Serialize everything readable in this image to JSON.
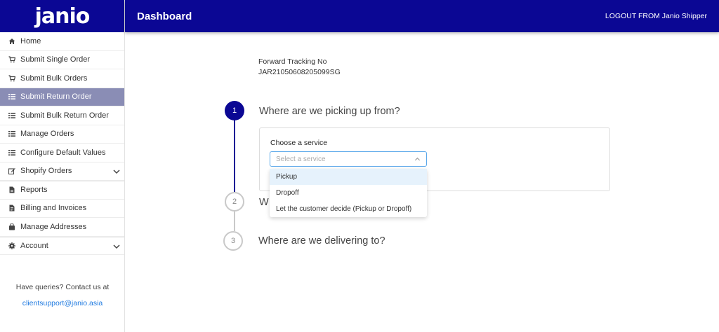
{
  "brand": {
    "logo_text": "janio",
    "color": "#0b0794"
  },
  "header": {
    "title": "Dashboard",
    "logout": "LOGOUT FROM Janio Shipper"
  },
  "sidebar": {
    "items": [
      {
        "label": "Home",
        "icon": "home-icon"
      },
      {
        "label": "Submit Single Order",
        "icon": "cart-icon"
      },
      {
        "label": "Submit Bulk Orders",
        "icon": "cart-icon"
      },
      {
        "label": "Submit Return Order",
        "icon": "list-icon",
        "active": true
      },
      {
        "label": "Submit Bulk Return Order",
        "icon": "list-icon"
      },
      {
        "label": "Manage Orders",
        "icon": "list-icon"
      },
      {
        "label": "Configure Default Values",
        "icon": "list-icon"
      },
      {
        "label": "Shopify Orders",
        "icon": "edit-icon",
        "expandable": true
      },
      {
        "label": "Reports",
        "icon": "file-icon"
      },
      {
        "label": "Billing and Invoices",
        "icon": "invoice-icon"
      },
      {
        "label": "Manage Addresses",
        "icon": "bag-icon"
      },
      {
        "label": "Account",
        "icon": "gear-icon",
        "expandable": true
      }
    ],
    "contact_text": "Have queries? Contact us at",
    "contact_email": "clientsupport@janio.asia"
  },
  "tracking": {
    "label": "Forward Tracking No",
    "value": "JAR21050608205099SG"
  },
  "steps": [
    {
      "number": "1",
      "title": "Where are we picking up from?"
    },
    {
      "number": "2",
      "title": "W"
    },
    {
      "number": "3",
      "title": "Where are we delivering to?"
    }
  ],
  "service": {
    "label": "Choose a service",
    "placeholder": "Select a service",
    "options": [
      "Pickup",
      "Dropoff",
      "Let the customer decide (Pickup or Dropoff)"
    ]
  }
}
